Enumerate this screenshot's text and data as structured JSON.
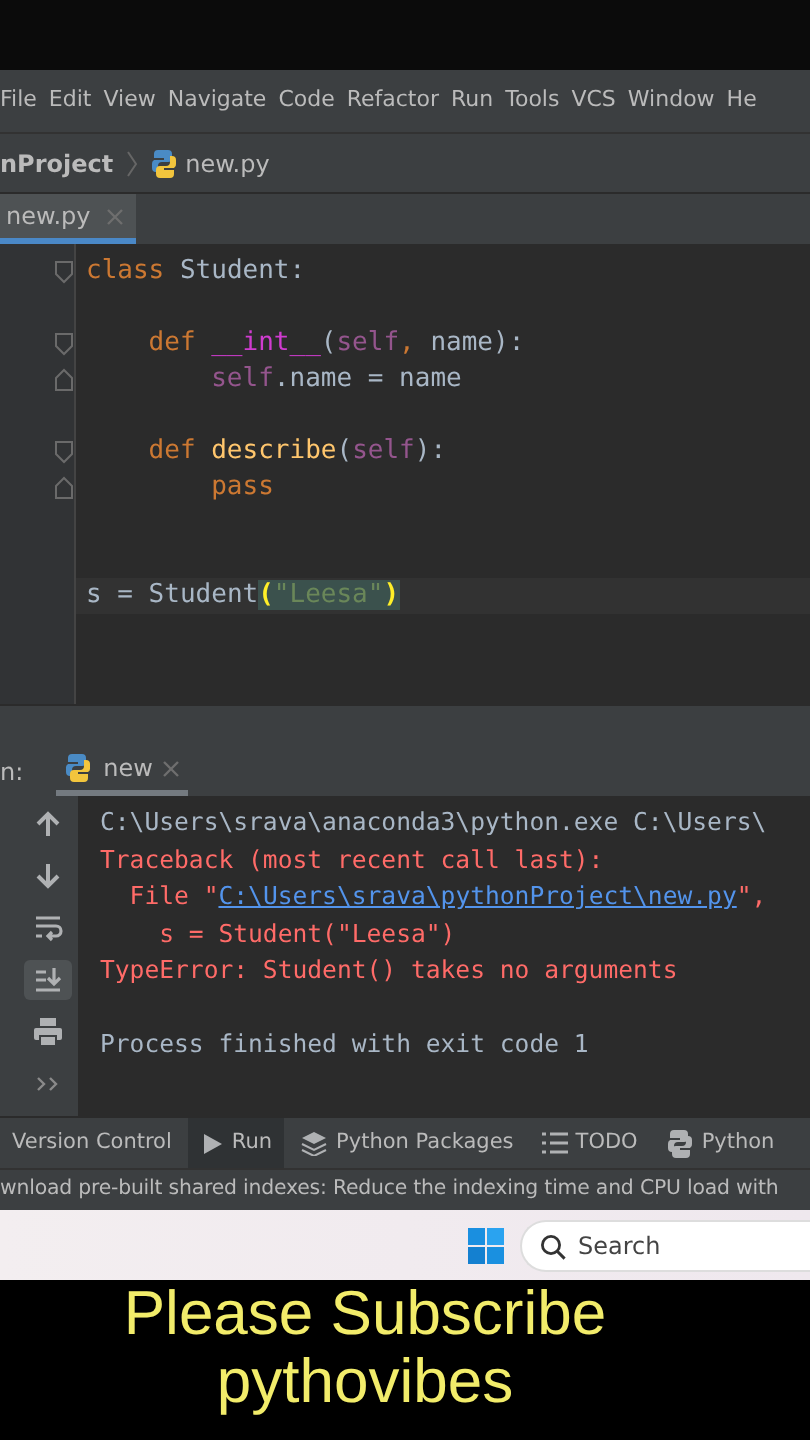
{
  "menu_bar": {
    "items": [
      "File",
      "Edit",
      "View",
      "Navigate",
      "Code",
      "Refactor",
      "Run",
      "Tools",
      "VCS",
      "Window",
      "He"
    ]
  },
  "breadcrumb": {
    "project": "nProject",
    "file": "new.py"
  },
  "editor_tabs": [
    {
      "label": "new.py",
      "selected": true
    }
  ],
  "editor": {
    "lines": [
      {
        "kind": "code",
        "fold_start": true,
        "fold_end": false,
        "tokens": [
          {
            "kind": "keyword",
            "text": "class"
          },
          {
            "kind": "plain",
            "text": " Student:"
          }
        ],
        "children": [
          {
            "kind": "blank"
          },
          {
            "kind": "code",
            "fold_start": true,
            "fold_end": false,
            "tokens": [
              {
                "kind": "keyword",
                "text": "def"
              },
              {
                "kind": "magic",
                "text": " __int__"
              },
              {
                "kind": "plain",
                "text": "("
              },
              {
                "kind": "self",
                "text": "self"
              },
              {
                "kind": "keyword",
                "text": ","
              },
              {
                "kind": "plain",
                "text": " name):"
              }
            ],
            "children": [
              {
                "kind": "code",
                "fold_start": false,
                "fold_end": true,
                "tokens": [
                  {
                    "kind": "self",
                    "text": "self"
                  },
                  {
                    "kind": "plain",
                    "text": ".name = name"
                  }
                ]
              }
            ]
          },
          {
            "kind": "blank"
          },
          {
            "kind": "code",
            "fold_start": true,
            "fold_end": false,
            "tokens": [
              {
                "kind": "keyword",
                "text": "def"
              },
              {
                "kind": "function",
                "text": " describe"
              },
              {
                "kind": "plain",
                "text": "("
              },
              {
                "kind": "self",
                "text": "self"
              },
              {
                "kind": "plain",
                "text": "):"
              }
            ],
            "children": [
              {
                "kind": "code",
                "fold_start": false,
                "fold_end": true,
                "tokens": [
                  {
                    "kind": "keyword",
                    "text": "pass"
                  }
                ]
              }
            ]
          }
        ]
      },
      {
        "kind": "blank"
      },
      {
        "kind": "blank"
      },
      {
        "kind": "code",
        "fold_start": false,
        "fold_end": false,
        "tokens": [
          {
            "kind": "plain",
            "text": "s = Student"
          },
          {
            "kind": "brace_match",
            "text": "("
          },
          {
            "kind": "string_match",
            "text": "\"Leesa\""
          },
          {
            "kind": "brace_match",
            "text": ")"
          }
        ]
      }
    ]
  },
  "run_panel": {
    "label": "n:",
    "tabs": [
      {
        "label": "new",
        "selected": true
      }
    ],
    "toolbar": [
      {
        "kind": "up",
        "selected": false
      },
      {
        "kind": "down",
        "selected": false
      },
      {
        "kind": "wrap",
        "selected": false
      },
      {
        "kind": "scroll_end",
        "selected": true
      },
      {
        "kind": "print",
        "selected": false
      },
      {
        "kind": "more",
        "selected": false
      }
    ],
    "console": [
      {
        "kind": "line",
        "tokens": [
          {
            "kind": "plain",
            "text": "C:\\Users\\srava\\anaconda3\\python.exe C:\\Users\\"
          }
        ]
      },
      {
        "kind": "line",
        "tokens": [
          {
            "kind": "error",
            "text": "Traceback (most recent call last):"
          }
        ]
      },
      {
        "kind": "line",
        "tokens": [
          {
            "kind": "error",
            "text": "  File \""
          },
          {
            "kind": "link",
            "text": "C:\\Users\\srava\\pythonProject\\new.py"
          },
          {
            "kind": "error",
            "text": "\","
          }
        ]
      },
      {
        "kind": "line",
        "tokens": [
          {
            "kind": "error",
            "text": "    s = Student(\"Leesa\")"
          }
        ]
      },
      {
        "kind": "line",
        "tokens": [
          {
            "kind": "error",
            "text": "TypeError: Student() takes no arguments"
          }
        ]
      },
      {
        "kind": "blank"
      },
      {
        "kind": "line",
        "tokens": [
          {
            "kind": "plain",
            "text": "Process finished with exit code 1"
          }
        ]
      }
    ]
  },
  "tool_windows": [
    {
      "kind": "vcs",
      "label": "Version Control",
      "selected": false
    },
    {
      "kind": "run",
      "label": "Run",
      "selected": true
    },
    {
      "kind": "packages",
      "label": "Python Packages",
      "selected": false
    },
    {
      "kind": "todo",
      "label": "TODO",
      "selected": false
    },
    {
      "kind": "python",
      "label": "Python",
      "selected": false
    }
  ],
  "status_bar": {
    "text": "wnload pre-built shared indexes: Reduce the indexing time and CPU load with"
  },
  "taskbar": {
    "search": {
      "placeholder": "Search"
    }
  },
  "caption": {
    "lines": [
      "Please Subscribe",
      "pythovibes"
    ]
  }
}
